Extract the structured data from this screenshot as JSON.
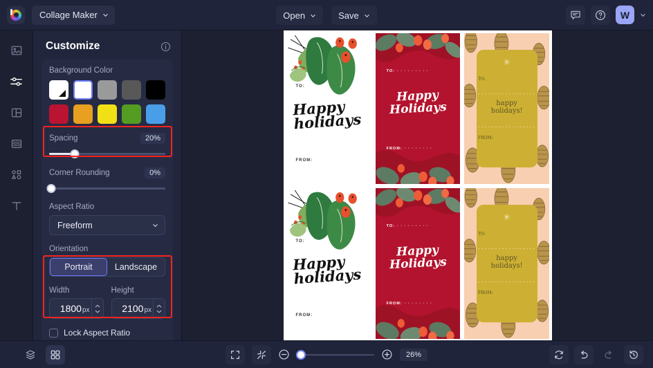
{
  "app": {
    "name": "Collage Maker",
    "logo_icon": "color-wheel-logo-icon"
  },
  "topbar": {
    "open_label": "Open",
    "save_label": "Save",
    "feedback_icon": "chat-bubble-icon",
    "help_icon": "question-circle-icon",
    "avatar_initial": "W",
    "account_caret_icon": "chevron-down-icon"
  },
  "rail": {
    "items": [
      {
        "name": "images",
        "icon": "image-icon",
        "active": false
      },
      {
        "name": "customize",
        "icon": "sliders-icon",
        "active": true
      },
      {
        "name": "layouts",
        "icon": "layout-grid-icon",
        "active": false
      },
      {
        "name": "textures",
        "icon": "texture-layers-icon",
        "active": false
      },
      {
        "name": "graphics",
        "icon": "shapes-icon",
        "active": false
      },
      {
        "name": "text",
        "icon": "text-t-icon",
        "active": false
      }
    ]
  },
  "panel": {
    "title": "Customize",
    "info_icon": "info-circle-icon",
    "background_color": {
      "label": "Background Color",
      "swatches": [
        {
          "name": "transparent",
          "hex": "transparent",
          "selected": false
        },
        {
          "name": "white",
          "hex": "#ffffff",
          "selected": true
        },
        {
          "name": "light-gray",
          "hex": "#9a9a9a",
          "selected": false
        },
        {
          "name": "dark-gray",
          "hex": "#585858",
          "selected": false
        },
        {
          "name": "black",
          "hex": "#000000",
          "selected": false
        },
        {
          "name": "crimson",
          "hex": "#bb1432",
          "selected": false
        },
        {
          "name": "orange",
          "hex": "#e8a020",
          "selected": false
        },
        {
          "name": "yellow",
          "hex": "#f2e016",
          "selected": false
        },
        {
          "name": "green",
          "hex": "#549c22",
          "selected": false
        },
        {
          "name": "blue",
          "hex": "#4a9ee8",
          "selected": false
        }
      ]
    },
    "spacing": {
      "label": "Spacing",
      "value": "20%",
      "percent": 20
    },
    "corner_rounding": {
      "label": "Corner Rounding",
      "value": "0%",
      "percent": 0
    },
    "aspect_ratio": {
      "label": "Aspect Ratio",
      "value": "Freeform",
      "caret_icon": "chevron-down-icon"
    },
    "orientation": {
      "label": "Orientation",
      "options": [
        {
          "label": "Portrait",
          "selected": true
        },
        {
          "label": "Landscape",
          "selected": false
        }
      ]
    },
    "width": {
      "label": "Width",
      "value": "1800",
      "unit": "px"
    },
    "height": {
      "label": "Height",
      "value": "2100",
      "unit": "px"
    },
    "lock_aspect_ratio": {
      "label": "Lock Aspect Ratio",
      "checked": false
    }
  },
  "highlights": [
    {
      "name": "spacing-highlight",
      "color": "#f8231f"
    },
    {
      "name": "dimensions-highlight",
      "color": "#f8231f"
    }
  ],
  "canvas": {
    "grid": {
      "columns": 3,
      "rows": 2
    },
    "cells": [
      {
        "design": "white-holly",
        "to": "TO:",
        "title_line1": "Happy",
        "title_line2": "holidays",
        "from": "FROM:"
      },
      {
        "design": "crimson-holly",
        "to": "TO:",
        "title_line1": "Happy",
        "title_line2": "Holidays",
        "from": "FROM:"
      },
      {
        "design": "pinecone-gold-tag",
        "to": "TO:",
        "title_line1": "happy",
        "title_line2": "holidays!",
        "from": "FROM:"
      },
      {
        "design": "white-holly",
        "to": "TO:",
        "title_line1": "Happy",
        "title_line2": "holidays",
        "from": "FROM:"
      },
      {
        "design": "crimson-holly",
        "to": "TO:",
        "title_line1": "Happy",
        "title_line2": "Holidays",
        "from": "FROM:"
      },
      {
        "design": "pinecone-gold-tag",
        "to": "TO:",
        "title_line1": "happy",
        "title_line2": "holidays!",
        "from": "FROM:"
      }
    ]
  },
  "bottombar": {
    "layers_icon": "layers-icon",
    "grid_icon": "grid-view-icon",
    "fit_icon": "fit-to-screen-icon",
    "shrink_icon": "shrink-icon",
    "zoom_out_icon": "minus-circle-icon",
    "zoom_in_icon": "plus-circle-icon",
    "zoom_value": "26%",
    "zoom_percent": 26,
    "reset_icon": "refresh-icon",
    "undo_icon": "undo-arrow-icon",
    "redo_icon": "redo-arrow-icon",
    "history_icon": "history-clock-icon"
  }
}
